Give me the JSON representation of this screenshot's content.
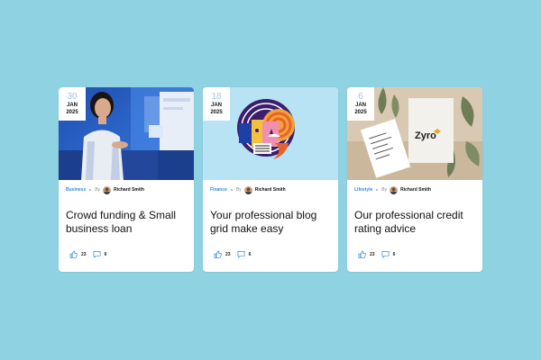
{
  "colors": {
    "background": "#8fd2e2",
    "card": "#ffffff",
    "category": "#2f8dde",
    "date_day": "#9fc5e6",
    "icon": "#2f8dde"
  },
  "cards": [
    {
      "date": {
        "day": "30",
        "month": "JAN",
        "year": "2025"
      },
      "category": "Business",
      "by": "By",
      "author": "Richard Smith",
      "title": "Crowd funding & Small business loan",
      "likes": "23",
      "comments": "6",
      "image": "office-woman-photo"
    },
    {
      "date": {
        "day": "18",
        "month": "JAN",
        "year": "2025"
      },
      "category": "Finance",
      "by": "By",
      "author": "Richard Smith",
      "title": "Your professional blog grid make easy",
      "likes": "23",
      "comments": "6",
      "image": "abstract-face-illustration"
    },
    {
      "date": {
        "day": "6",
        "month": "JAN",
        "year": "2025"
      },
      "category": "Lifestyle",
      "by": "By",
      "author": "Richard Smith",
      "title": "Our professional credit rating advice",
      "likes": "23",
      "comments": "6",
      "image": "stationery-mockup-photo",
      "image_brand": "Zyro"
    }
  ]
}
